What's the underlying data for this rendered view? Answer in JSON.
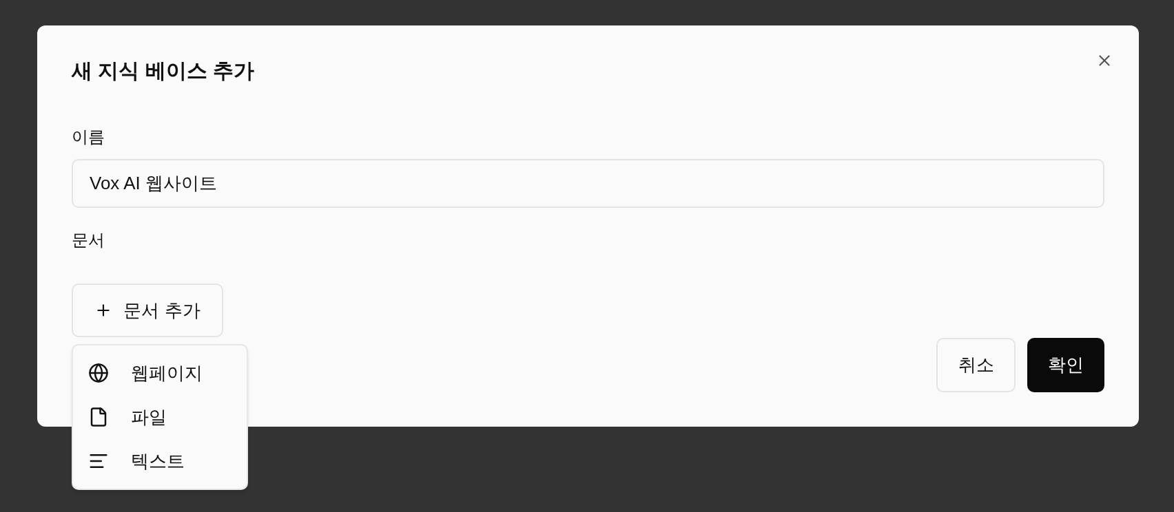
{
  "dialog": {
    "title": "새 지식 베이스 추가"
  },
  "name_field": {
    "label": "이름",
    "value": "Vox AI 웹사이트"
  },
  "documents": {
    "label": "문서",
    "add_button": "문서 추가"
  },
  "add_menu": {
    "open": true,
    "items": [
      {
        "kind": "webpage",
        "label": "웹페이지"
      },
      {
        "kind": "file",
        "label": "파일"
      },
      {
        "kind": "text",
        "label": "텍스트"
      }
    ]
  },
  "buttons": {
    "cancel": "취소",
    "confirm": "확인"
  }
}
